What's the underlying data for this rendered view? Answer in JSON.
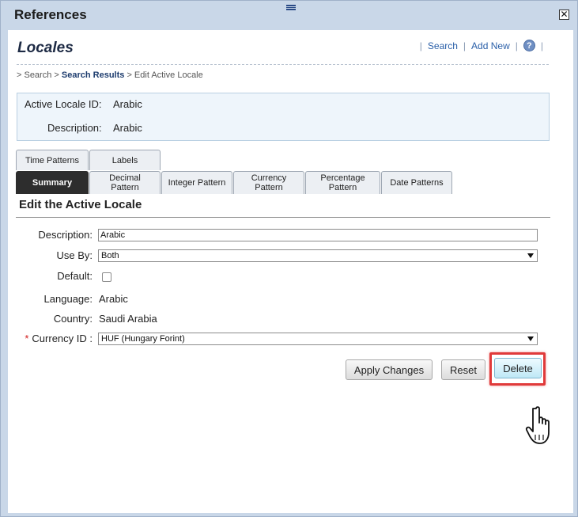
{
  "window": {
    "title": "References",
    "close_glyph": "✕"
  },
  "header": {
    "page_title": "Locales",
    "links": {
      "search": "Search",
      "add_new": "Add New",
      "help": "?"
    }
  },
  "breadcrumb": {
    "prefix": "> Search >",
    "current_link": "Search Results",
    "suffix": "> Edit Active Locale"
  },
  "info": {
    "id_label": "Active Locale ID:",
    "id_value": "Arabic",
    "desc_label": "Description:",
    "desc_value": "Arabic"
  },
  "tabs": {
    "row1": [
      "Time Patterns",
      "Labels"
    ],
    "row2": [
      "Summary",
      "Decimal\nPattern",
      "Integer Pattern",
      "Currency\nPattern",
      "Percentage\nPattern",
      "Date Patterns"
    ],
    "active": "Summary"
  },
  "form": {
    "section_title": "Edit the Active Locale",
    "description_label": "Description:",
    "description_value": "Arabic",
    "use_by_label": "Use By:",
    "use_by_value": "Both",
    "default_label": "Default:",
    "default_checked": false,
    "language_label": "Language:",
    "language_value": "Arabic",
    "country_label": "Country:",
    "country_value": "Saudi Arabia",
    "currency_required_marker": "*",
    "currency_label": "Currency ID :",
    "currency_value": "HUF (Hungary Forint)"
  },
  "buttons": {
    "apply": "Apply Changes",
    "reset": "Reset",
    "delete": "Delete"
  },
  "colors": {
    "highlight": "#e03a3a",
    "link": "#2a5fa8",
    "active_tab": "#2d2d2d"
  }
}
